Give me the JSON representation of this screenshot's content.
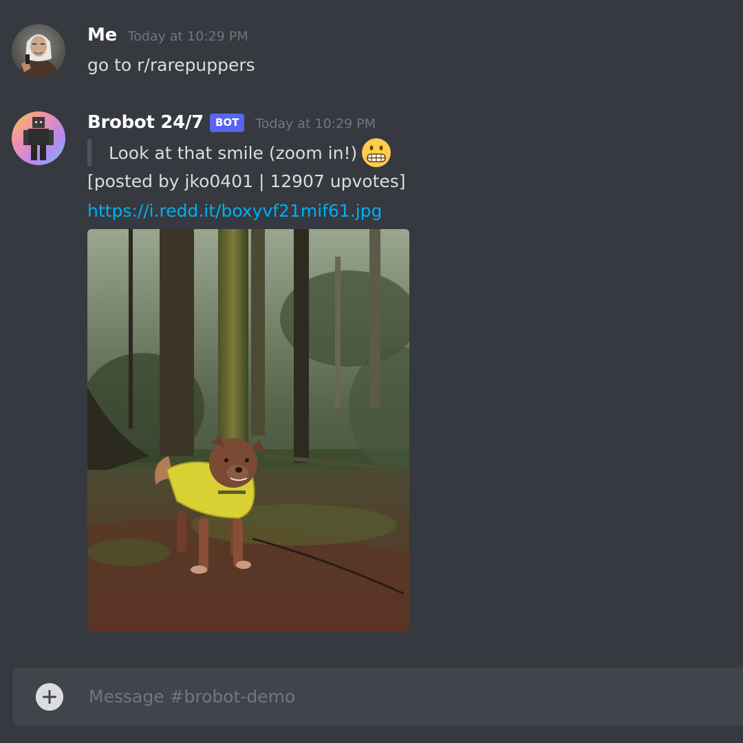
{
  "messages": [
    {
      "author": "Me",
      "timestamp": "Today at 10:29 PM",
      "text": "go to r/rarepuppers",
      "avatar_icon": "witcher-avatar"
    },
    {
      "author": "Brobot 24/7",
      "badge": "BOT",
      "timestamp": "Today at 10:29 PM",
      "quote": "Look at that smile (zoom in!)",
      "emoji": "grimacing-face",
      "meta": "[posted by jko0401 | 12907 upvotes]",
      "link": "https://i.redd.it/boxyvf21mif61.jpg",
      "image_subject": "dog-in-yellow-jacket-in-forest",
      "avatar_icon": "robot-avatar"
    }
  ],
  "composer": {
    "placeholder": "Message #brobot-demo",
    "add_icon": "plus-circle-icon"
  },
  "colors": {
    "background": "#36393f",
    "composer": "#40444b",
    "bot_badge": "#5865f2",
    "link": "#00aff4",
    "timestamp": "#72767d"
  }
}
